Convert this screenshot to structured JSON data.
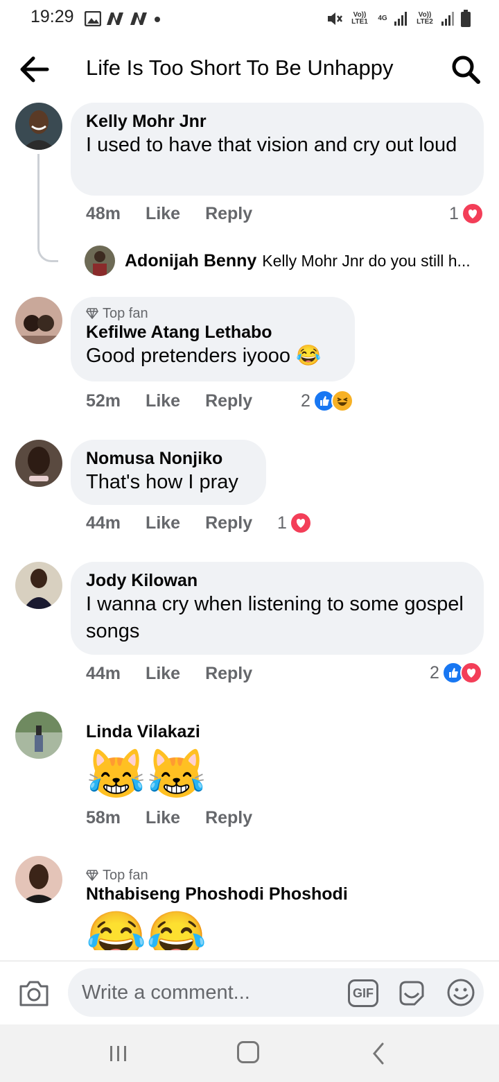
{
  "status_bar": {
    "time": "19:29",
    "sim1_label": "Vo)) LTE1",
    "network_label": "4G",
    "sim2_label": "Vo)) LTE2"
  },
  "header": {
    "title": "Life Is Too Short To Be Unhappy",
    "back_icon": "arrow-left-icon",
    "search_icon": "search-icon"
  },
  "comments": [
    {
      "name": "Kelly Mohr Jnr",
      "text": "I used to have that vision and cry out loud",
      "time": "48m",
      "like_label": "Like",
      "reply_label": "Reply",
      "reaction_count": "1",
      "reactions": [
        "love"
      ],
      "reply": {
        "name": "Adonijah Benny",
        "text": "Kelly Mohr Jnr do you still h..."
      }
    },
    {
      "top_fan": "Top fan",
      "name": "Kefilwe Atang Lethabo",
      "text": "Good pretenders iyooo 😂",
      "time": "52m",
      "like_label": "Like",
      "reply_label": "Reply",
      "reaction_count": "2",
      "reactions": [
        "like",
        "haha"
      ]
    },
    {
      "name": "Nomusa Nonjiko",
      "text": "That's how I pray",
      "time": "44m",
      "like_label": "Like",
      "reply_label": "Reply",
      "reaction_count": "1",
      "reactions": [
        "love"
      ]
    },
    {
      "name": "Jody Kilowan",
      "text": "I wanna cry when listening to some gospel songs",
      "time": "44m",
      "like_label": "Like",
      "reply_label": "Reply",
      "reaction_count": "2",
      "reactions": [
        "like",
        "love"
      ]
    },
    {
      "name": "Linda Vilakazi",
      "text": "😹😹",
      "time": "58m",
      "like_label": "Like",
      "reply_label": "Reply"
    },
    {
      "top_fan": "Top fan",
      "name": "Nthabiseng Phoshodi Phoshodi",
      "text": "😂😂"
    }
  ],
  "composer": {
    "placeholder": "Write a comment...",
    "gif_label": "GIF"
  },
  "colors": {
    "bubble": "#f0f2f5",
    "secondary_text": "#65676b",
    "like_blue": "#1877f2",
    "love_red": "#f33e58"
  }
}
